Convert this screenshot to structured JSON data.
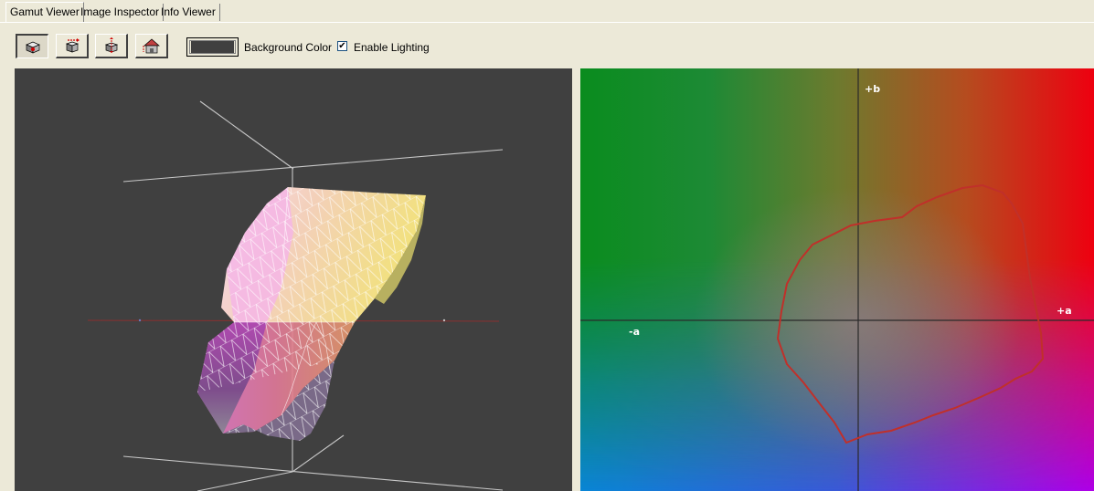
{
  "tabs": [
    {
      "label": "Gamut Viewer",
      "active": true
    },
    {
      "label": "Image Inspector",
      "active": false
    },
    {
      "label": "Info Viewer",
      "active": false
    }
  ],
  "toolbar": {
    "buttons": [
      {
        "icon": "rotate-view-icon",
        "pressed": true
      },
      {
        "icon": "pan-view-icon",
        "pressed": false
      },
      {
        "icon": "zoom-view-icon",
        "pressed": false
      },
      {
        "icon": "home-view-icon",
        "pressed": false
      }
    ],
    "background_color_label": "Background Color",
    "background_color": "#404040",
    "enable_lighting_label": "Enable Lighting",
    "enable_lighting_checked": true
  },
  "plot2d": {
    "plus_b": "+b",
    "plus_a": "+a",
    "minus_a": "-a",
    "gamut_outline_color": "#C0302A"
  }
}
